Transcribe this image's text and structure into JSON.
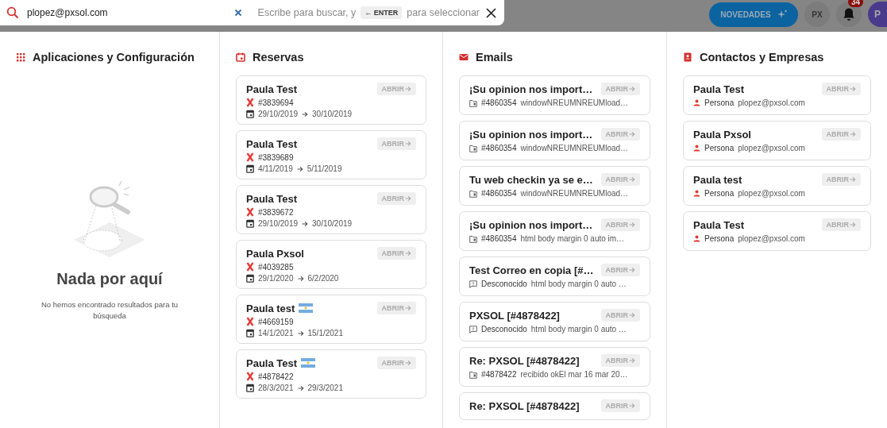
{
  "search": {
    "value": "plopez@pxsol.com",
    "hint_before": "Escribe para buscar, y",
    "key": "← ENTER",
    "hint_after": "para seleccionar"
  },
  "topbar": {
    "news_button": "NOVEDADES",
    "logo_badge": "PX",
    "notifications": "34",
    "avatar": "P"
  },
  "apps": {
    "title": "Aplicaciones y Configuración",
    "empty_title": "Nada por aquí",
    "empty_text": "No hemos encontrado resultados para tu búsqueda"
  },
  "reservas": {
    "title": "Reservas",
    "items": [
      {
        "name": "Paula Test",
        "flag": false,
        "code": "#3839694",
        "from": "29/10/2019",
        "to": "30/10/2019",
        "action": "ABRIR"
      },
      {
        "name": "Paula Test",
        "flag": false,
        "code": "#3839689",
        "from": "4/11/2019",
        "to": "5/11/2019",
        "action": "ABRIR"
      },
      {
        "name": "Paula Test",
        "flag": false,
        "code": "#3839672",
        "from": "29/10/2019",
        "to": "30/10/2019",
        "action": "ABRIR"
      },
      {
        "name": "Paula Pxsol",
        "flag": false,
        "code": "#4039285",
        "from": "29/1/2020",
        "to": "6/2/2020",
        "action": "ABRIR"
      },
      {
        "name": "Paula test",
        "flag": true,
        "code": "#4669159",
        "from": "14/1/2021",
        "to": "15/1/2021",
        "action": "ABRIR"
      },
      {
        "name": "Paula Test",
        "flag": true,
        "code": "#4878422",
        "from": "28/3/2021",
        "to": "29/3/2021",
        "action": "ABRIR"
      }
    ]
  },
  "emails": {
    "title": "Emails",
    "items": [
      {
        "subject": "¡Su opinion nos import…",
        "kind": "reservation",
        "ref": "#4860354",
        "preview": "windowNREUMNREUMload…",
        "action": "ABRIR"
      },
      {
        "subject": "¡Su opinion nos import…",
        "kind": "reservation",
        "ref": "#4860354",
        "preview": "windowNREUMNREUMload…",
        "action": "ABRIR"
      },
      {
        "subject": "Tu web checkin ya se e…",
        "kind": "reservation",
        "ref": "#4860354",
        "preview": "windowNREUMNREUMload…",
        "action": "ABRIR"
      },
      {
        "subject": "¡Su opinion nos import…",
        "kind": "reservation",
        "ref": "#4860354",
        "preview": "html body margin 0 auto im…",
        "action": "ABRIR"
      },
      {
        "subject": "Test Correo en copia [#…",
        "kind": "unknown",
        "ref": "Desconocido",
        "preview": "html body margin 0 auto …",
        "action": "ABRIR"
      },
      {
        "subject": "PXSOL [#4878422]",
        "kind": "unknown",
        "ref": "Desconocido",
        "preview": "html body margin 0 auto …",
        "action": "ABRIR"
      },
      {
        "subject": "Re: PXSOL [#4878422]",
        "kind": "reservation",
        "ref": "#4878422",
        "preview": "recibido okEl mar 16 mar 20…",
        "action": "ABRIR"
      },
      {
        "subject": "Re: PXSOL [#4878422]",
        "action": "ABRIR"
      }
    ]
  },
  "contactos": {
    "title": "Contactos y Empresas",
    "items": [
      {
        "name": "Paula Test",
        "type": "Persona",
        "email": "plopez@pxsol.com",
        "action": "ABRIR"
      },
      {
        "name": "Paula Pxsol",
        "type": "Persona",
        "email": "plopez@pxsol.com",
        "action": "ABRIR"
      },
      {
        "name": "Paula test",
        "type": "Persona",
        "email": "plopez@pxsol.com",
        "action": "ABRIR"
      },
      {
        "name": "Paula Test",
        "type": "Persona",
        "email": "plopez@pxsol.com",
        "action": "ABRIR"
      }
    ]
  }
}
